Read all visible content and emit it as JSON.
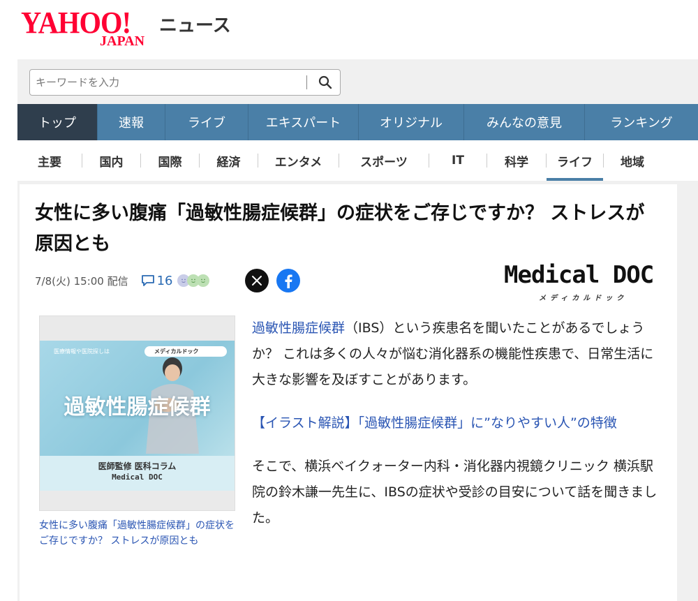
{
  "header": {
    "logo_main": "YAHOO!",
    "logo_sub": "JAPAN",
    "service_name": "ニュース"
  },
  "search": {
    "placeholder": "キーワードを入力"
  },
  "main_nav": [
    {
      "label": "トップ",
      "active": true
    },
    {
      "label": "速報"
    },
    {
      "label": "ライブ"
    },
    {
      "label": "エキスパート"
    },
    {
      "label": "オリジナル"
    },
    {
      "label": "みんなの意見"
    },
    {
      "label": "ランキング"
    }
  ],
  "sub_nav": [
    {
      "label": "主要"
    },
    {
      "label": "国内"
    },
    {
      "label": "国際"
    },
    {
      "label": "経済"
    },
    {
      "label": "エンタメ"
    },
    {
      "label": "スポーツ"
    },
    {
      "label": "IT"
    },
    {
      "label": "科学"
    },
    {
      "label": "ライフ",
      "active": true
    },
    {
      "label": "地域"
    }
  ],
  "article": {
    "title": "女性に多い腹痛「過敏性腸症候群」の症状をご存じですか？ ストレスが原因とも",
    "date": "7/8(火) 15:00 配信",
    "comment_count": "16",
    "publisher_logo": "Medical DOC",
    "publisher_sub": "メディカルドック",
    "thumbnail": {
      "top_text": "医療情報や医院探しは",
      "search_label": "メディカルドック",
      "big_title": "過敏性腸症候群",
      "supervision": "医師監修 医科コラム",
      "brand": "Medical DOC"
    },
    "caption": "女性に多い腹痛「過敏性腸症候群」の症状をご存じですか？ ストレスが原因とも",
    "body": {
      "p1_link": "過敏性腸症候群",
      "p1_text": "（IBS）という疾患名を聞いたことがあるでしょうか？ これは多くの人々が悩む消化器系の機能性疾患で、日常生活に大きな影響を及ぼすことがあります。",
      "p2_link": "【イラスト解説】「過敏性腸症候群」に”なりやすい人”の特徴",
      "p3_text": "そこで、横浜ベイクォーター内科・消化器内視鏡クリニック 横浜駅院の鈴木謙一先生に、IBSの症状や受診の目安について話を聞きました。"
    }
  },
  "colors": {
    "brand_red": "#ff0033",
    "nav_blue": "#4a7fa7",
    "nav_active": "#2f3e4d",
    "link_blue": "#2a55b3"
  }
}
